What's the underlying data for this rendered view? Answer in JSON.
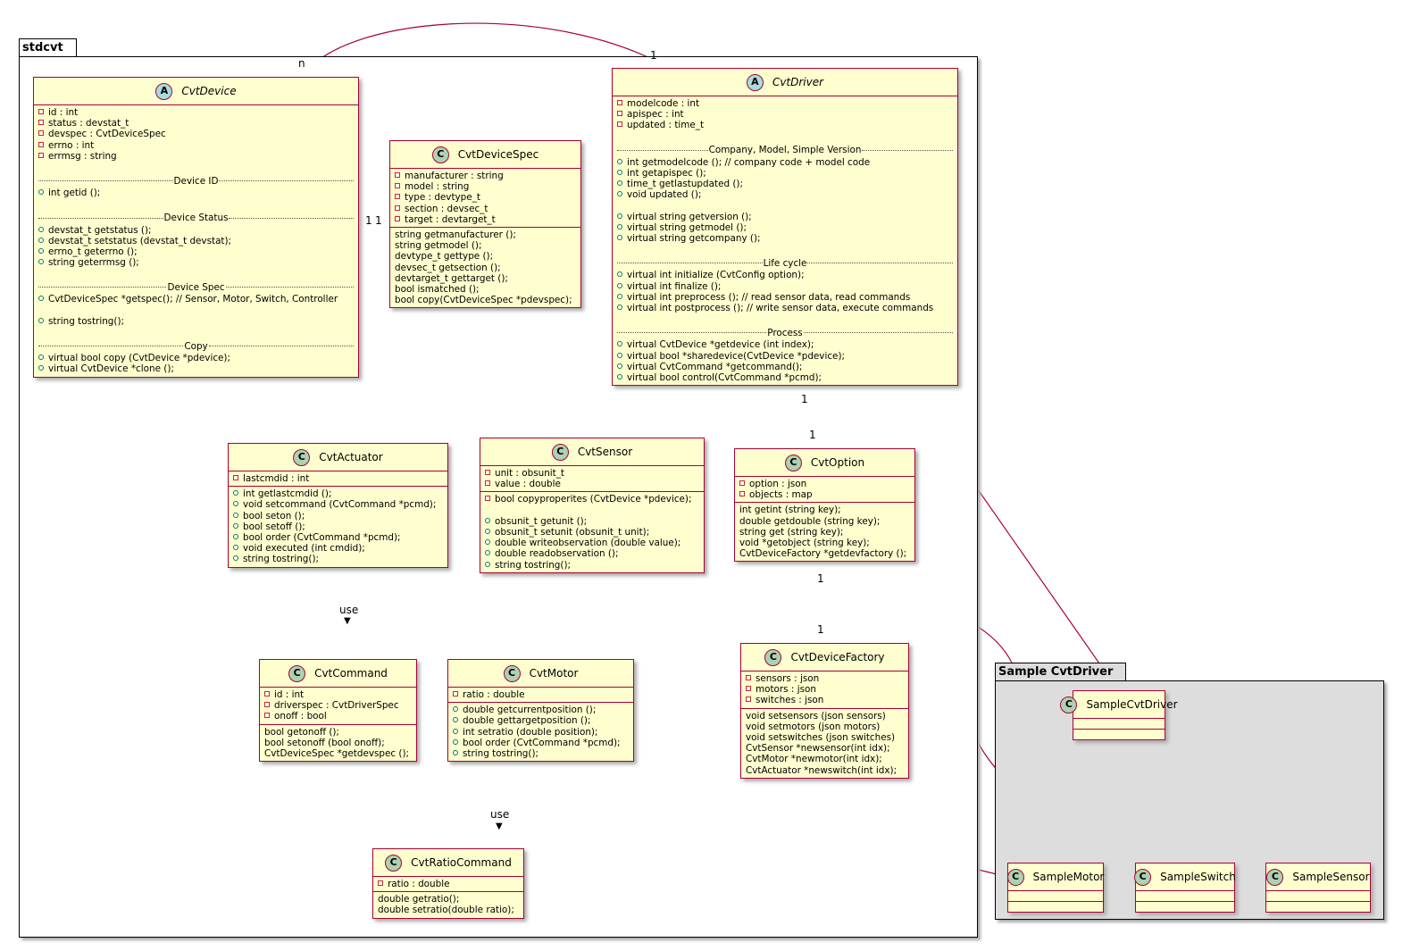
{
  "packages": {
    "main": "stdcvt",
    "sample": "Sample CvtDriver"
  },
  "colors": {
    "class_fill": "#fefece",
    "class_border": "#a80036",
    "sample_package_fill": "#dddddd",
    "class_badge": "#add1b2",
    "abstract_badge": "#a9dcdf"
  },
  "classes": {
    "CvtDevice": {
      "name": "CvtDevice",
      "stereotype": "A",
      "abstract": true,
      "sections": [
        [
          {
            "vis": "private",
            "text": "id : int"
          },
          {
            "vis": "private",
            "text": "status : devstat_t"
          },
          {
            "vis": "private",
            "text": "devspec : CvtDeviceSpec"
          },
          {
            "vis": "private",
            "text": "errno : int"
          },
          {
            "vis": "private",
            "text": "errmsg : string"
          },
          {
            "blank": true
          },
          {
            "sep": "Device ID"
          },
          {
            "vis": "public",
            "text": "int getid ();"
          },
          {
            "blank": true
          },
          {
            "sep": "Device Status"
          },
          {
            "vis": "public",
            "text": "devstat_t getstatus ();"
          },
          {
            "vis": "public",
            "text": "devstat_t setstatus (devstat_t devstat);"
          },
          {
            "vis": "public",
            "text": "errno_t geterrno ();"
          },
          {
            "vis": "public",
            "text": "string geterrmsg ();"
          },
          {
            "blank": true
          },
          {
            "sep": "Device Spec"
          },
          {
            "vis": "public",
            "text": "CvtDeviceSpec *getspec(); // Sensor, Motor, Switch, Controller"
          },
          {
            "blank": true
          },
          {
            "vis": "public",
            "text": "string tostring();"
          },
          {
            "blank": true
          },
          {
            "sep": "Copy"
          },
          {
            "vis": "public",
            "text": "virtual bool copy (CvtDevice *pdevice);"
          },
          {
            "vis": "public",
            "text": "virtual CvtDevice *clone ();"
          }
        ]
      ]
    },
    "CvtDeviceSpec": {
      "name": "CvtDeviceSpec",
      "stereotype": "C",
      "abstract": false,
      "sections": [
        [
          {
            "vis": "private",
            "text": "manufacturer : string"
          },
          {
            "vis": "private",
            "text": "model : string"
          },
          {
            "vis": "private",
            "text": "type : devtype_t"
          },
          {
            "vis": "private",
            "text": "section : devsec_t"
          },
          {
            "vis": "private",
            "text": "target : devtarget_t"
          }
        ],
        [
          {
            "text": "string getmanufacturer ();"
          },
          {
            "text": "string getmodel ();"
          },
          {
            "text": "devtype_t gettype ();"
          },
          {
            "text": "devsec_t getsection ();"
          },
          {
            "text": "devtarget_t gettarget ();"
          },
          {
            "text": "bool ismatched ();"
          },
          {
            "text": "bool copy(CvtDeviceSpec *pdevspec);"
          }
        ]
      ]
    },
    "CvtDriver": {
      "name": "CvtDriver",
      "stereotype": "A",
      "abstract": true,
      "sections": [
        [
          {
            "vis": "private",
            "text": "modelcode : int"
          },
          {
            "vis": "private",
            "text": "apispec : int"
          },
          {
            "vis": "private",
            "text": "updated : time_t"
          },
          {
            "blank": true
          },
          {
            "sep": "Company, Model, Simple Version"
          },
          {
            "vis": "public",
            "text": "int getmodelcode ();      // company code + model code"
          },
          {
            "vis": "public",
            "text": "int getapispec ();"
          },
          {
            "vis": "public",
            "text": "time_t getlastupdated ();"
          },
          {
            "vis": "public",
            "text": "void updated ();"
          },
          {
            "blank": true
          },
          {
            "vis": "public",
            "text": "virtual string getversion ();"
          },
          {
            "vis": "public",
            "text": "virtual string getmodel ();"
          },
          {
            "vis": "public",
            "text": "virtual string getcompany ();"
          },
          {
            "blank": true
          },
          {
            "sep": "Life cycle"
          },
          {
            "vis": "public",
            "text": "virtual int initialize (CvtConfig option);"
          },
          {
            "vis": "public",
            "text": "virtual int finalize ();"
          },
          {
            "vis": "public",
            "text": "virtual int preprocess (); // read sensor data, read commands"
          },
          {
            "vis": "public",
            "text": "virtual int postprocess (); // write sensor data, execute commands"
          },
          {
            "blank": true
          },
          {
            "sep": "Process"
          },
          {
            "vis": "public",
            "text": "virtual CvtDevice *getdevice (int index);"
          },
          {
            "vis": "public",
            "text": "virtual bool *sharedevice(CvtDevice *pdevice);"
          },
          {
            "vis": "public",
            "text": "virtual CvtCommand *getcommand();"
          },
          {
            "vis": "public",
            "text": "virtual bool control(CvtCommand *pcmd);"
          }
        ]
      ]
    },
    "CvtActuator": {
      "name": "CvtActuator",
      "stereotype": "C",
      "abstract": false,
      "sections": [
        [
          {
            "vis": "private",
            "text": "lastcmdid : int"
          }
        ],
        [
          {
            "vis": "public",
            "text": "int getlastcmdid ();"
          },
          {
            "vis": "public",
            "text": "void setcommand (CvtCommand *pcmd);"
          },
          {
            "vis": "public",
            "text": "bool seton ();"
          },
          {
            "vis": "public",
            "text": "bool setoff ();"
          },
          {
            "vis": "public",
            "text": "bool order (CvtCommand *pcmd);"
          },
          {
            "vis": "public",
            "text": "void executed (int cmdid);"
          },
          {
            "vis": "public",
            "text": "string tostring();"
          }
        ]
      ]
    },
    "CvtSensor": {
      "name": "CvtSensor",
      "stereotype": "C",
      "abstract": false,
      "sections": [
        [
          {
            "vis": "private",
            "text": "unit : obsunit_t"
          },
          {
            "vis": "private",
            "text": "value : double"
          }
        ],
        [
          {
            "vis": "private",
            "text": "bool copyproperites (CvtDevice *pdevice);"
          },
          {
            "blank": true
          },
          {
            "vis": "public",
            "text": "obsunit_t getunit ();"
          },
          {
            "vis": "public",
            "text": "obsunit_t setunit (obsunit_t unit);"
          },
          {
            "vis": "public",
            "text": "double writeobservation (double value);"
          },
          {
            "vis": "public",
            "text": "double readobservation ();"
          },
          {
            "vis": "public",
            "text": "string tostring();"
          }
        ]
      ]
    },
    "CvtOption": {
      "name": "CvtOption",
      "stereotype": "C",
      "abstract": false,
      "sections": [
        [
          {
            "vis": "private",
            "text": "option : json"
          },
          {
            "vis": "private",
            "text": "objects : map"
          }
        ],
        [
          {
            "text": "int getint (string key);"
          },
          {
            "text": "double getdouble (string key);"
          },
          {
            "text": "string get (string key);"
          },
          {
            "text": "void *getobject (string key);"
          },
          {
            "text": "CvtDeviceFactory *getdevfactory ();"
          }
        ]
      ]
    },
    "CvtCommand": {
      "name": "CvtCommand",
      "stereotype": "C",
      "abstract": false,
      "sections": [
        [
          {
            "vis": "private",
            "text": "id : int"
          },
          {
            "vis": "private",
            "text": "driverspec : CvtDriverSpec"
          },
          {
            "vis": "private",
            "text": "onoff : bool"
          }
        ],
        [
          {
            "text": "bool getonoff ();"
          },
          {
            "text": "bool setonoff (bool onoff);"
          },
          {
            "text": "CvtDeviceSpec *getdevspec ();"
          }
        ]
      ]
    },
    "CvtMotor": {
      "name": "CvtMotor",
      "stereotype": "C",
      "abstract": false,
      "sections": [
        [
          {
            "vis": "private",
            "text": "ratio : double"
          }
        ],
        [
          {
            "vis": "public",
            "text": "double getcurrentposition ();"
          },
          {
            "vis": "public",
            "text": "double gettargetposition ();"
          },
          {
            "vis": "public",
            "text": "int setratio (double position);"
          },
          {
            "vis": "public",
            "text": "bool order (CvtCommand *pcmd);"
          },
          {
            "vis": "public",
            "text": "string tostring();"
          }
        ]
      ]
    },
    "CvtDeviceFactory": {
      "name": "CvtDeviceFactory",
      "stereotype": "C",
      "abstract": false,
      "sections": [
        [
          {
            "vis": "private",
            "text": "sensors : json"
          },
          {
            "vis": "private",
            "text": "motors : json"
          },
          {
            "vis": "private",
            "text": "switches : json"
          }
        ],
        [
          {
            "text": "void setsensors (json sensors)"
          },
          {
            "text": "void setmotors (json motors)"
          },
          {
            "text": "void setswitches (json switches)"
          },
          {
            "text": "CvtSensor *newsensor(int idx);"
          },
          {
            "text": "CvtMotor *newmotor(int idx);"
          },
          {
            "text": "CvtActuator *newswitch(int idx);"
          }
        ]
      ]
    },
    "CvtRatioCommand": {
      "name": "CvtRatioCommand",
      "stereotype": "C",
      "abstract": false,
      "sections": [
        [
          {
            "vis": "private",
            "text": "ratio : double"
          }
        ],
        [
          {
            "text": "double getratio();"
          },
          {
            "text": "double setratio(double ratio);"
          }
        ]
      ]
    },
    "SampleCvtDriver": {
      "name": "SampleCvtDriver",
      "stereotype": "C",
      "abstract": false,
      "sections": [
        [],
        []
      ]
    },
    "SampleMotor": {
      "name": "SampleMotor",
      "stereotype": "C",
      "abstract": false,
      "sections": [
        [],
        []
      ]
    },
    "SampleSwitch": {
      "name": "SampleSwitch",
      "stereotype": "C",
      "abstract": false,
      "sections": [
        [],
        []
      ]
    },
    "SampleSensor": {
      "name": "SampleSensor",
      "stereotype": "C",
      "abstract": false,
      "sections": [
        [],
        []
      ]
    }
  },
  "labels": {
    "n": "n",
    "one": "1",
    "use": "use",
    "use_arrow": "▼"
  }
}
